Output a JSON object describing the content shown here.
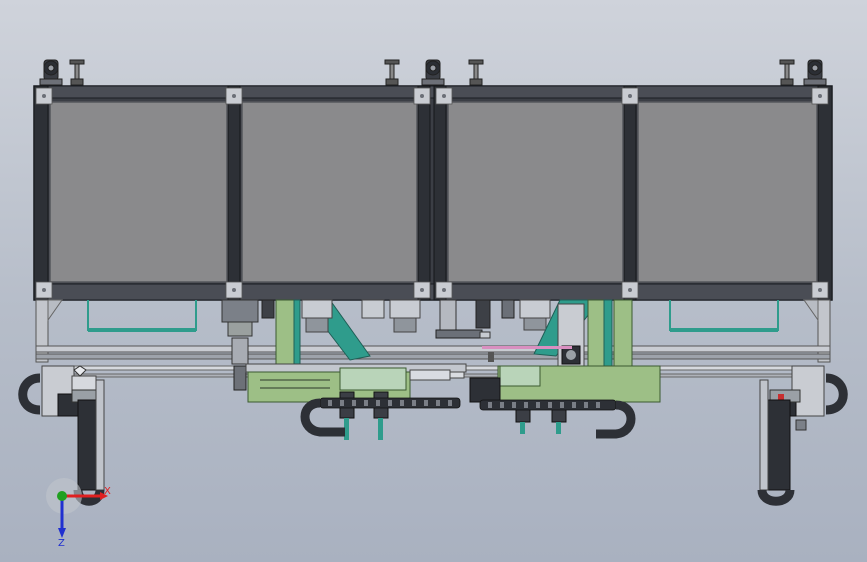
{
  "viewport": {
    "background_top": "#cfd3db",
    "background_bottom": "#a9b1c0"
  },
  "colors": {
    "frame_dark": "#2a2d33",
    "panel": "#8a8a8c",
    "aluminum": "#c9ccd2",
    "plate_green": "#9dbf86",
    "teal": "#2f9c8c",
    "pink_cable": "#d98fc0",
    "axis_x": "#e02020",
    "axis_y": "#20a020",
    "axis_z": "#2030d0"
  },
  "triad": {
    "x_label": "X",
    "z_label": "Z"
  },
  "icons": {
    "triad": "coordinate-triad-icon"
  }
}
